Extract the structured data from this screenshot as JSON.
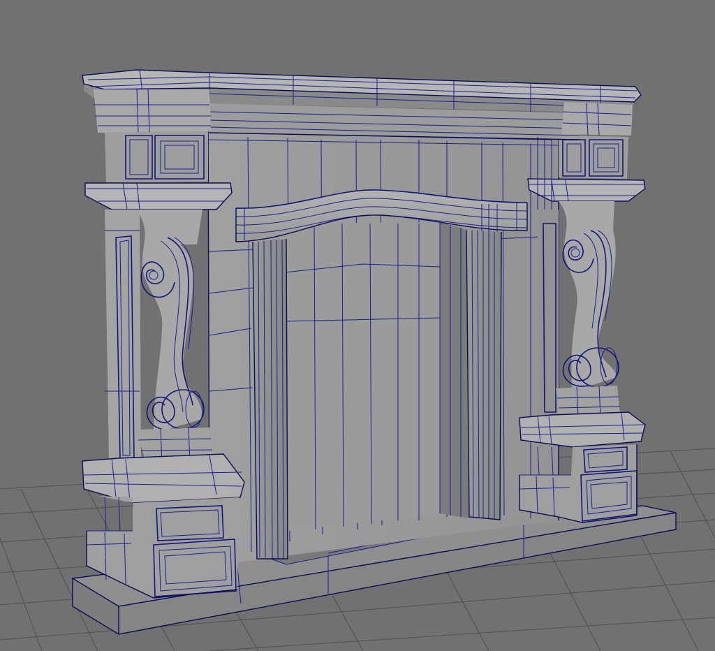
{
  "viewport": {
    "background_color": "#717171",
    "grid_color": "#4f4f4f",
    "mesh_fill_light": "#a3a3a3",
    "mesh_fill_mid": "#8e8e8e",
    "mesh_fill_dark": "#6e6e6e",
    "wireframe_color": "#1d1d8c",
    "subject": "fireplace-mantel-model",
    "display_mode": "wireframe-on-shaded"
  }
}
